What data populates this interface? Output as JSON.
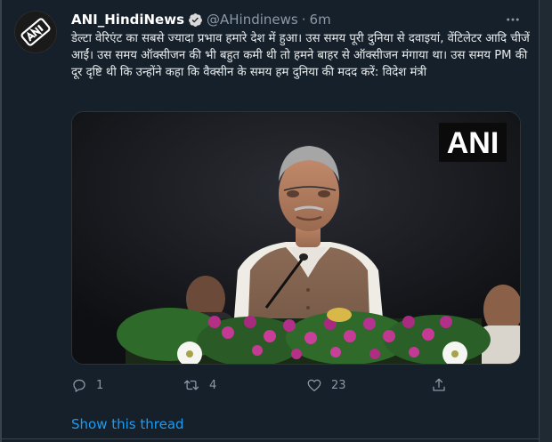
{
  "tweet": {
    "display_name": "ANI_HindiNews",
    "handle": "@AHindinews",
    "separator": "·",
    "time": "6m",
    "text": "डेल्टा वेरिएंट का सबसे ज्यादा प्रभाव हमारे देश में हुआ। उस समय पूरी दुनिया से दवाइयां, वेंटिलेटर आदि चीजें आईं। उस समय ऑक्सीजन की भी बहुत कमी थी तो हमने बाहर से ऑक्सीजन मंगाया था। उस समय PM की दूर दृष्टि थी कि उन्होंने कहा कि वैक्सीन के समय हम दुनिया की मदद करें: विदेश मंत्री",
    "media_watermark": "ANI",
    "avatar_logo_text": "ANI"
  },
  "actions": {
    "reply_count": "1",
    "retweet_count": "4",
    "like_count": "23"
  },
  "thread_link": "Show this thread",
  "icons": {
    "reply": "reply-icon",
    "retweet": "retweet-icon",
    "like": "heart-icon",
    "share": "share-icon",
    "more": "more-icon",
    "verified": "verified-badge-icon"
  },
  "colors": {
    "background": "#15202b",
    "link": "#1d9bf0",
    "muted": "#8b98a5",
    "text": "#e7e9ea",
    "verified": "#d9d9d9"
  }
}
